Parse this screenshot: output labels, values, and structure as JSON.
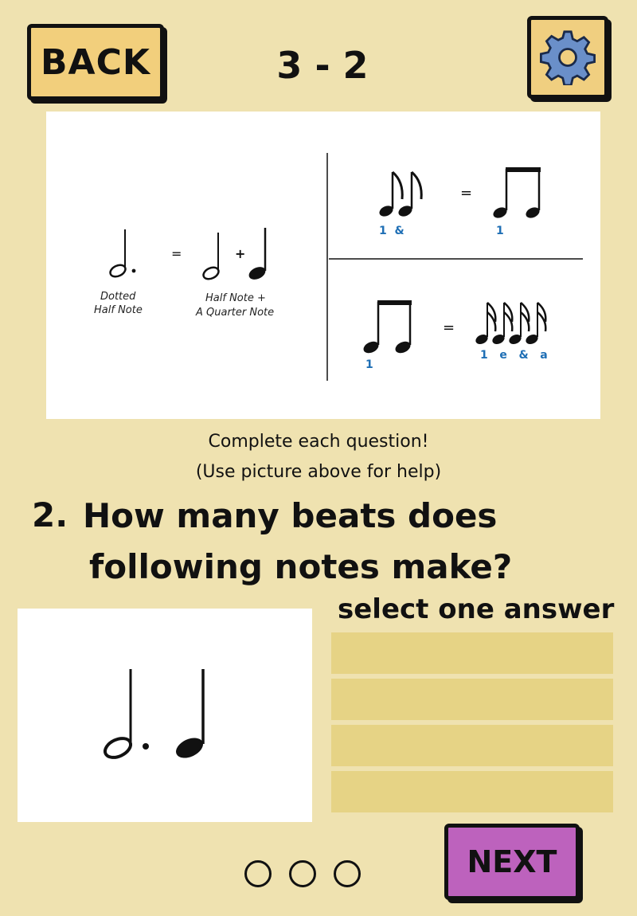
{
  "header": {
    "back_label": "BACK",
    "level": "3 - 2",
    "settings_icon": "gear-icon"
  },
  "help_image": {
    "left_equation": {
      "dotted_label_1": "Dotted",
      "dotted_label_2": "Half Note",
      "equals": "=",
      "plus": "+",
      "sum_label_1": "Half Note +",
      "sum_label_2": "A Quarter Note"
    },
    "eighth_row": {
      "left_counts": "1  &",
      "right_counts": "1",
      "equals": "="
    },
    "sixteenth_row": {
      "left_counts": "1",
      "right_counts": "1   e   &   a",
      "equals": "="
    },
    "count_color": "#1f6fb5"
  },
  "instructions": {
    "line1": "Complete each question!",
    "line2": "(Use picture above for help)"
  },
  "question": {
    "number": "2.",
    "line1": "How many beats does",
    "line2": "following notes make?",
    "notes": [
      "dotted-half-note",
      "quarter-note"
    ]
  },
  "answers": {
    "label": "select one answer",
    "options": [
      "",
      "",
      "",
      ""
    ]
  },
  "footer": {
    "next_label": "NEXT",
    "progress_dots": 3
  },
  "colors": {
    "background": "#efe2b0",
    "back_button": "#f2cf7c",
    "next_button": "#bd62bd",
    "answer_slot": "#e6d385",
    "gear": "#6a8fc9"
  }
}
